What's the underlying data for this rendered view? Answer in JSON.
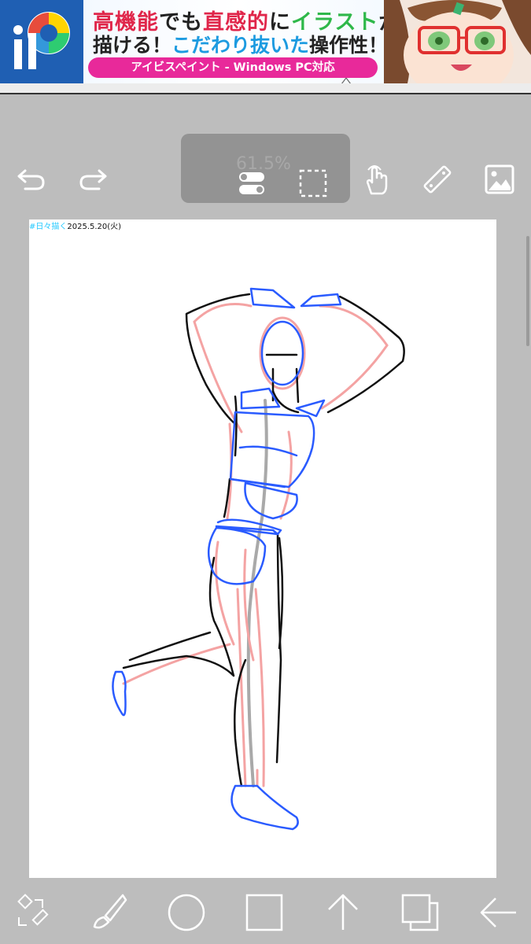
{
  "ad": {
    "line1_a": "高機能",
    "line1_b": "でも",
    "line1_c": "直感的",
    "line1_d": "に",
    "line1_e": "イラスト",
    "line1_f": "が",
    "line2_a": "描ける！",
    "line2_b": "こだわり抜いた",
    "line2_c": "操作性！",
    "pill": "アイビスペイント - Windows PC対応",
    "logo_letters": "iP"
  },
  "toolbar": {
    "undo_icon": "undo-icon",
    "redo_icon": "redo-icon",
    "zoom_percent": "61.5%",
    "gesture_icon": "hand-touch-icon",
    "ruler_icon": "ruler-icon",
    "reference_icon": "image-icon"
  },
  "canvas": {
    "tag": "#日々描く",
    "date": "2025.5.20(火)"
  },
  "bottom_bar": {
    "items": [
      "transform-icon",
      "brush-icon",
      "circle-icon",
      "square-icon",
      "arrow-up-icon",
      "layers-icon",
      "back-arrow-icon"
    ]
  },
  "colors": {
    "background": "#bdbdbd",
    "icon": "#ffffff",
    "sketch_blue": "#2a5bff",
    "sketch_red": "#f4a3a3",
    "sketch_black": "#111111",
    "sketch_gray": "#a9a9a9"
  }
}
